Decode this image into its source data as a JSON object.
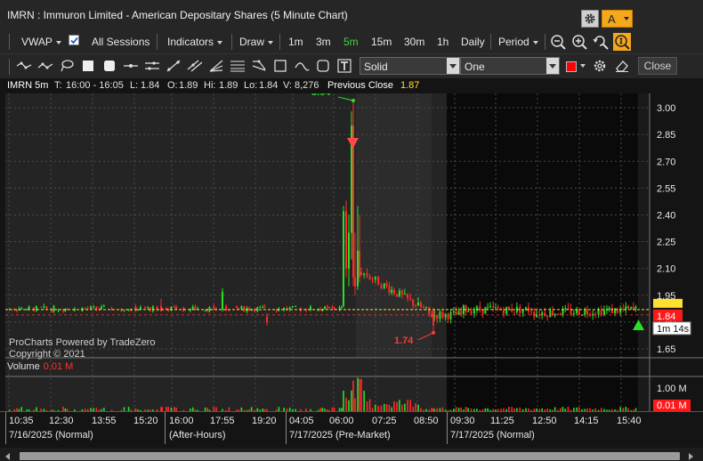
{
  "window": {
    "title": "IMRN : Immuron Limited - American Depositary Shares (5 Minute Chart)",
    "account_label": "A"
  },
  "toolbar": {
    "vwap": "VWAP",
    "all_sessions": "All Sessions",
    "indicators": "Indicators",
    "draw": "Draw",
    "intervals": [
      "1m",
      "3m",
      "5m",
      "15m",
      "30m",
      "1h",
      "Daily"
    ],
    "active_interval": "5m",
    "period": "Period"
  },
  "drawbar": {
    "line_style": "Solid",
    "line_width": "One",
    "color": "#ff0000",
    "close_label": "Close"
  },
  "info": {
    "symbol": "IMRN 5m",
    "time_label": "T:",
    "time": "16:00 - 16:05",
    "low_label": "L:",
    "low": "1.84",
    "open_label": "O:",
    "open": "1.89",
    "hi_label": "Hi:",
    "hi": "1.89",
    "lo_label": "Lo:",
    "lo": "1.84",
    "vol_label": "V:",
    "vol": "8,276",
    "prev_close_label": "Previous Close",
    "prev_close": "1.87"
  },
  "watermark": {
    "line1": "ProCharts Powered by TradeZero",
    "line2": "Copyright © 2021"
  },
  "chart_data": {
    "type": "candlestick",
    "y_ticks": [
      "3.00",
      "2.85",
      "2.70",
      "2.55",
      "2.40",
      "2.25",
      "2.10",
      "1.95",
      "1.80",
      "1.65"
    ],
    "ylim": [
      1.6,
      3.08
    ],
    "high_marker": "3.04",
    "low_marker": "1.74",
    "last_price": "1.84",
    "previous_close_price": 1.87,
    "countdown": "1m 14s",
    "volume_label": "Volume",
    "volume_value": "0.01 M",
    "volume_ticks": [
      "1.00 M",
      "0.01 M"
    ],
    "time_ticks": [
      "10:35",
      "12:30",
      "13:55",
      "15:20",
      "16:00",
      "17:55",
      "19:20",
      "04:05",
      "06:00",
      "07:25",
      "08:50",
      "09:30",
      "11:25",
      "12:50",
      "14:15",
      "15:40"
    ],
    "sessions": [
      "7/16/2025 (Normal)",
      "(After-Hours)",
      "7/17/2025 (Pre-Market)",
      "7/17/2025 (Normal)"
    ]
  },
  "colors": {
    "up": "#27e027",
    "down": "#ff2a2a",
    "accent": "#f5a81c",
    "prev_close_line": "#ffe030"
  }
}
